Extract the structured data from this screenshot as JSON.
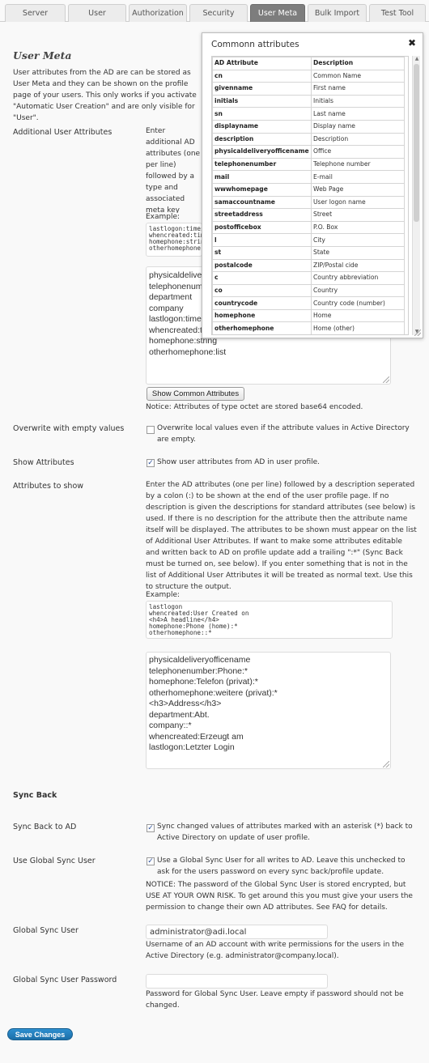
{
  "tabs": [
    "Server",
    "User",
    "Authorization",
    "Security",
    "User Meta",
    "Bulk Import",
    "Test Tool"
  ],
  "active_tab": "User Meta",
  "page_title": "User Meta",
  "intro_text": "User attributes from the AD are can be stored as User Meta and they can be shown on the profile page of your users. This only works if you activate \"Automatic User Creation\" and are only visible for \"User\".",
  "additional": {
    "label": "Additional User Attributes",
    "description": "Enter additional AD attributes (one per line) followed by a type and associated meta key name seperated by a colon (:). All attributes should appear on the list of Additional User Attributes. Format: <attribute>:<type>:<meta key> where type can be one of the following: string, list, integer, bool, time, timestamp, octet. If no <meta key> is set, the attributes will be stored as adi_<attribute_name>.",
    "example_label": "Example:",
    "example_lines": [
      "lastlogon:timestamp",
      "whencreated:time",
      "homephone:string",
      "otherhomephone:list"
    ],
    "value_lines": [
      "physicaldeliveryofficename",
      "telephonenumber",
      "department",
      "company",
      "lastlogon:timestamp",
      "whencreated:time",
      "homephone:string",
      "otherhomephone:list"
    ],
    "button": "Show Common Attributes",
    "notice": "Notice: Attributes of type octet are stored base64 encoded."
  },
  "overwrite": {
    "label": "Overwrite with empty values",
    "text": "Overwrite local values even if the attribute values in Active Directory are empty.",
    "checked": false
  },
  "show_attributes": {
    "label": "Show Attributes",
    "text": "Show user attributes from AD in user profile.",
    "checked": true
  },
  "attributes_to_show": {
    "label": "Attributes to show",
    "description": "Enter the AD attributes (one per line) followed by a description seperated by a colon (:) to be shown at the end of the user profile page. If no description is given the descriptions for standard attributes (see below) is used. If there is no description for the attribute then the attribute name itself will be displayed. The attributes to be shown must appear on the list of Additional User Attributes. If want to make some attributes editable and written back to AD on profile update add a trailing \":*\" (Sync Back must be turned on, see below). If you enter something that is not in the list of Additional User Attributes it will be treated as normal text. Use this to structure the output.",
    "example_label": "Example:",
    "example_lines": [
      "lastlogon",
      "whencreated:User Created on",
      "<h4>A headline</h4>",
      "homephone:Phone (home):*",
      "otherhomephone::*"
    ],
    "value_lines": [
      "physicaldeliveryofficename",
      "telephonenumber:Phone:*",
      "homephone:Telefon (privat):*",
      "otherhomephone:weitere (privat):*",
      "<h3>Address</h3>",
      "department:Abt.",
      "company::*",
      "whencreated:Erzeugt am",
      "lastlogon:Letzter Login"
    ]
  },
  "sync_back_heading": "Sync Back",
  "sync_back": {
    "label": "Sync Back to AD",
    "text": "Sync changed values of attributes marked with an asterisk (*) back to Active Directory on update of user profile.",
    "checked": true
  },
  "global_sync": {
    "label": "Use Global Sync User",
    "text": "Use a Global Sync User for all writes to AD. Leave this unchecked to ask for the users password on every sync back/profile update.",
    "notice": "NOTICE: The password of the Global Sync User is stored encrypted, but USE AT YOUR OWN RISK. To get around this you must give your users the permission to change their own AD attributes. See FAQ for details.",
    "checked": true
  },
  "global_sync_user": {
    "label": "Global Sync User",
    "value": "administrator@adi.local",
    "help": "Username of an AD account with write permissions for the users in the Active Directory (e.g. administrator@company.local)."
  },
  "global_sync_password": {
    "label": "Global Sync User Password",
    "value": "",
    "help": "Password for Global Sync User. Leave empty if password should not be changed."
  },
  "save_button": "Save Changes",
  "popup": {
    "title": "Commonn attributes",
    "close": "✖",
    "headers": [
      "AD Attribute",
      "Description"
    ],
    "rows": [
      [
        "cn",
        "Common Name"
      ],
      [
        "givenname",
        "First name"
      ],
      [
        "initials",
        "Initials"
      ],
      [
        "sn",
        "Last name"
      ],
      [
        "displayname",
        "Display name"
      ],
      [
        "description",
        "Description"
      ],
      [
        "physicaldeliveryofficename",
        "Office"
      ],
      [
        "telephonenumber",
        "Telephone number"
      ],
      [
        "mail",
        "E-mail"
      ],
      [
        "wwwhomepage",
        "Web Page"
      ],
      [
        "samaccountname",
        "User logon name"
      ],
      [
        "streetaddress",
        "Street"
      ],
      [
        "postofficebox",
        "P.O. Box"
      ],
      [
        "l",
        "City"
      ],
      [
        "st",
        "State"
      ],
      [
        "postalcode",
        "ZIP/Postal cide"
      ],
      [
        "c",
        "Country abbreviation"
      ],
      [
        "co",
        "Country"
      ],
      [
        "countrycode",
        "Country code (number)"
      ],
      [
        "homephone",
        "Home"
      ],
      [
        "otherhomephone",
        "Home (other)"
      ]
    ]
  }
}
